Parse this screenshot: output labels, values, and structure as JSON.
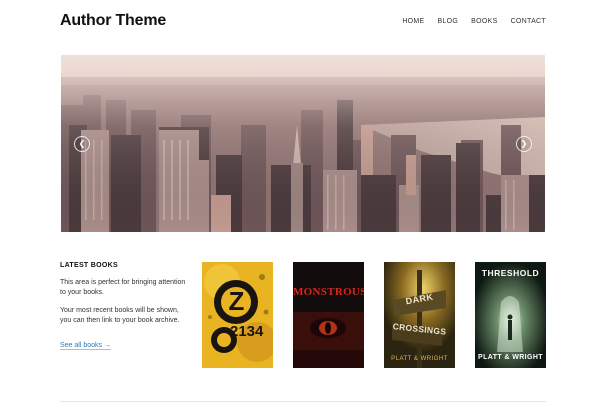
{
  "site": {
    "title": "Author Theme"
  },
  "nav": [
    {
      "label": "HOME"
    },
    {
      "label": "BLOG"
    },
    {
      "label": "BOOKS"
    },
    {
      "label": "CONTACT"
    }
  ],
  "slider": {
    "prev_glyph": "❮",
    "next_glyph": "❯",
    "prev_icon": "chevron-left-icon",
    "next_icon": "chevron-right-icon"
  },
  "latest_books": {
    "heading": "LATEST BOOKS",
    "para1": "This area is perfect for bringing attention to your books.",
    "para2": "Your most recent books will be shown, you can then link to your book archive.",
    "link_label": "See all books →"
  },
  "books": [
    {
      "title_top": "Z",
      "title_bottom": "2134",
      "line1": "2134",
      "author": ""
    },
    {
      "title_top": "MONSTROUS",
      "author": ""
    },
    {
      "title_top": "DARK",
      "title_bottom": "CROSSINGS",
      "author": "PLATT & WRIGHT"
    },
    {
      "title_top": "THRESHOLD",
      "author": "PLATT & WRIGHT"
    }
  ]
}
